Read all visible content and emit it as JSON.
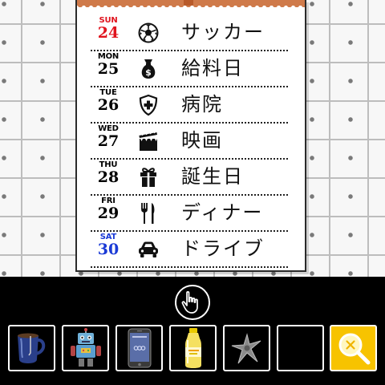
{
  "calendar": {
    "rows": [
      {
        "dow": "SUN",
        "date": "24",
        "icon": "soccer-ball-icon",
        "label": "サッカー",
        "color": "#e0141e"
      },
      {
        "dow": "MON",
        "date": "25",
        "icon": "money-bag-icon",
        "label": "給料日",
        "color": "#111111"
      },
      {
        "dow": "TUE",
        "date": "26",
        "icon": "medical-shield-icon",
        "label": "病院",
        "color": "#111111"
      },
      {
        "dow": "WED",
        "date": "27",
        "icon": "clapperboard-icon",
        "label": "映画",
        "color": "#111111"
      },
      {
        "dow": "THU",
        "date": "28",
        "icon": "gift-icon",
        "label": "誕生日",
        "color": "#111111"
      },
      {
        "dow": "FRI",
        "date": "29",
        "icon": "fork-knife-icon",
        "label": "ディナー",
        "color": "#111111"
      },
      {
        "dow": "SAT",
        "date": "30",
        "icon": "car-icon",
        "label": "ドライブ",
        "color": "#1a3ad6"
      }
    ]
  },
  "inventory": {
    "items": [
      {
        "name": "coffee-mug-item",
        "icon": "mug-icon"
      },
      {
        "name": "toy-robot-item",
        "icon": "robot-icon"
      },
      {
        "name": "smartphone-item",
        "icon": "phone-icon"
      },
      {
        "name": "drink-bottle-item",
        "icon": "bottle-icon"
      },
      {
        "name": "metal-part-item",
        "icon": "cross-part-icon"
      },
      {
        "name": "empty-slot",
        "icon": ""
      },
      {
        "name": "magnifier-slot",
        "icon": "magnifier-icon",
        "selected": true
      }
    ]
  },
  "colors": {
    "sunday": "#e0141e",
    "saturday": "#1a3ad6",
    "selected_slot": "#f7c300",
    "calendar_strip": "#cf7a4a"
  }
}
